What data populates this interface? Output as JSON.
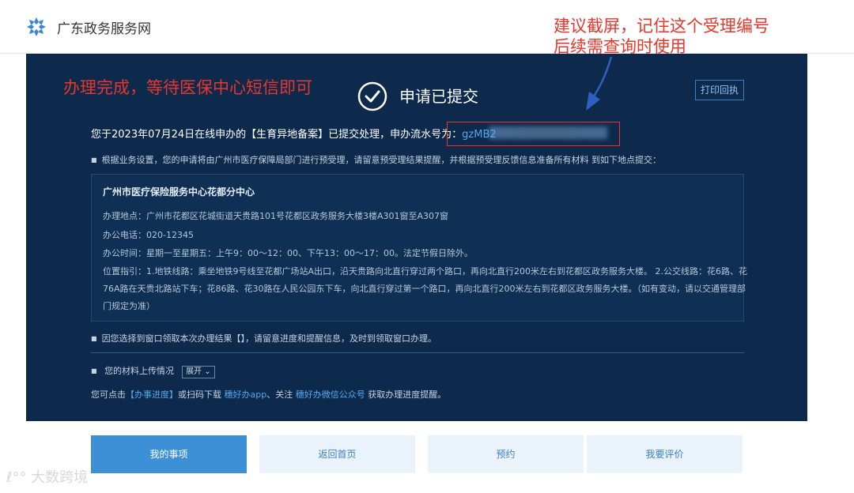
{
  "header": {
    "site_name": "广东政务服务网",
    "logo_icon": "snowflake-logo-icon"
  },
  "annotations": {
    "tip_line1": "建议截屏，记住这个受理编号",
    "tip_line2": "后续需查询时使用",
    "done": "办理完成，等待医保中心短信即可"
  },
  "status": {
    "title": "申请已提交",
    "print_button": "打印回执"
  },
  "summary": {
    "text": "您于2023年07月24日在线申办的【生育异地备案】已提交处理，申办流水号为：",
    "code_prefix": "gzMB2"
  },
  "notice1": "根据业务设置，您的申请将由广州市医疗保障局部门进行预受理，请留意预受理结果提醒，并根据预受理反馈信息准备所有材料 到如下地点提交：",
  "office": {
    "name": "广州市医疗保险服务中心花都分中心",
    "address": "办理地点：广州市花都区花城街道天贵路101号花都区政务服务大楼3楼A301窗至A307窗",
    "phone": "办公电话：020-12345",
    "hours": "办公时间：星期一至星期五：上午9：00～12：00、下午13：00～17：00。法定节假日除外。",
    "directions_1": "位置指引：1.地铁线路：乘坐地铁9号线至花都广场站A出口，沿天贵路向北直行穿过两个路口，再向北直行200米左右到花都区政务服务大楼。 2.公交线路：花6路、花",
    "directions_2": "76A路在天贵北路站下车；花86路、花30路在人民公园东下车，向北直行穿过第一个路口，再向北直行200米左右到花都区政务服务大楼。（如有变动，请以交通管理部",
    "directions_3": "门规定为准）"
  },
  "notice2": "因您选择到窗口领取本次办理结果【】，请留意进度和提醒信息，及时到领取窗口办理。",
  "materials": {
    "label": "您的材料上传情况",
    "expand": "展开"
  },
  "footer": {
    "prefix": "您可点击",
    "link_progress": "【办事进度】",
    "middle": "或扫码下载",
    "link_app": "穗好办app",
    "sep": "、关注",
    "link_wechat": "穗好办微信公众号",
    "suffix": "获取办理进度提醒。"
  },
  "buttons": {
    "my_items": "我的事项",
    "home": "返回首页",
    "appointment": "预约",
    "rate": "我要评价"
  },
  "watermark": "大数跨境",
  "colors": {
    "panel": "#0d2a4d",
    "accent": "#3d8fd6",
    "annotation": "#e8362a"
  }
}
